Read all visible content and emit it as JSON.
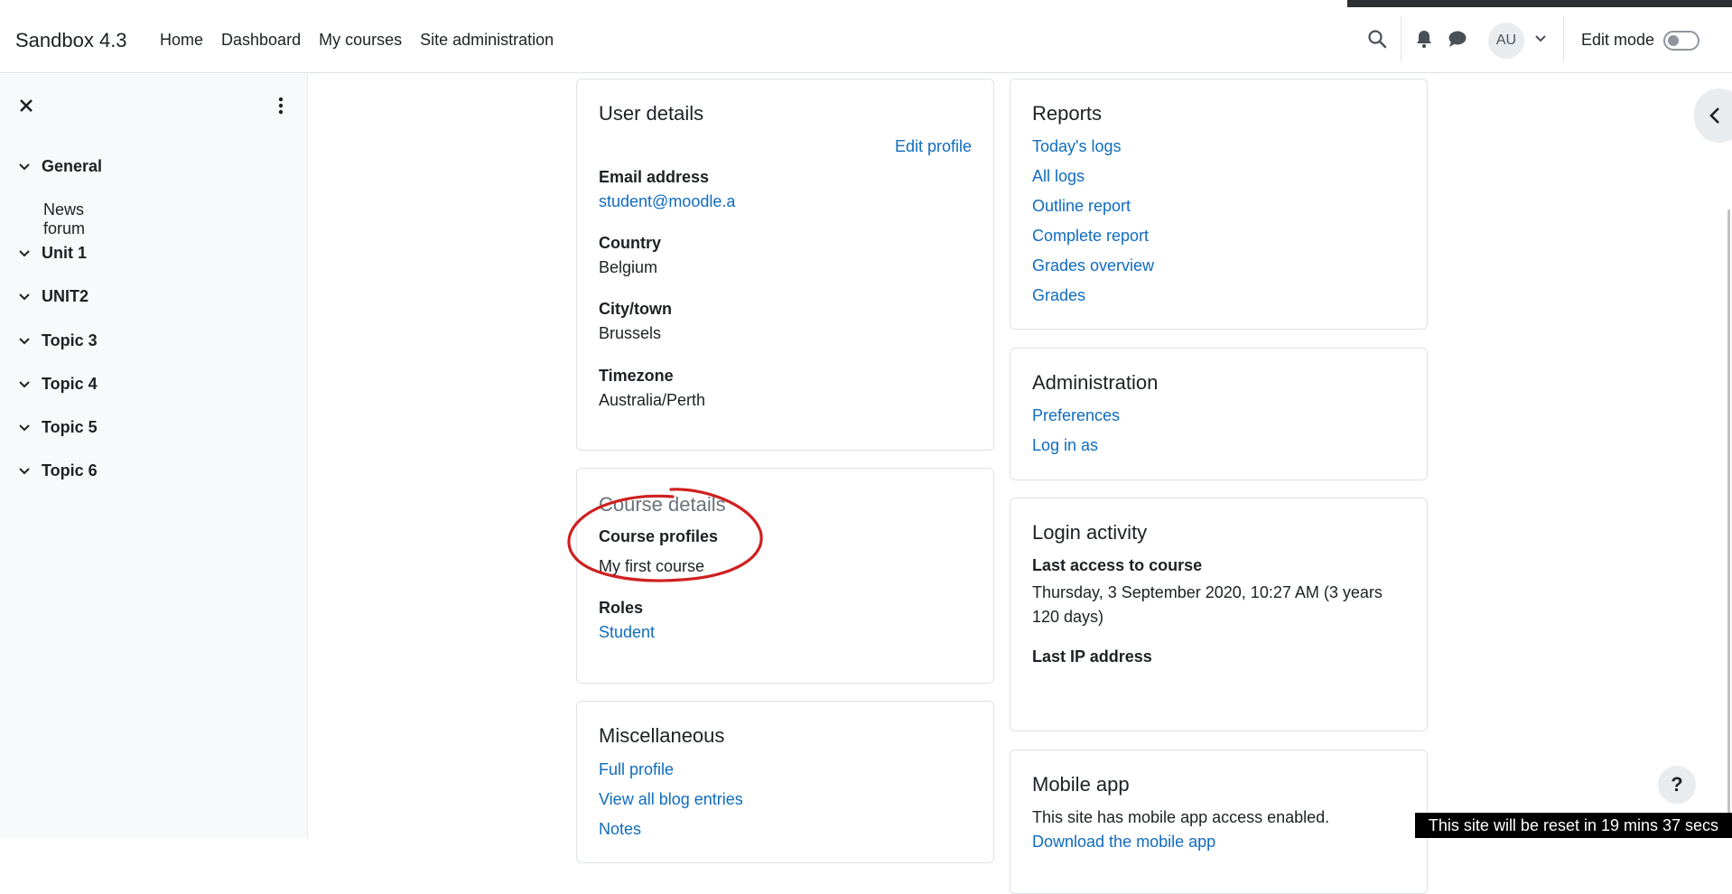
{
  "navbar": {
    "brand": "Sandbox 4.3",
    "links": [
      "Home",
      "Dashboard",
      "My courses",
      "Site administration"
    ],
    "avatar_initials": "AU",
    "edit_mode_label": "Edit mode",
    "edit_mode_on": false
  },
  "course_index": {
    "sections": [
      {
        "label": "General",
        "items": [
          "News forum"
        ]
      },
      {
        "label": "Unit 1",
        "items": []
      },
      {
        "label": "UNIT2",
        "items": []
      },
      {
        "label": "Topic 3",
        "items": []
      },
      {
        "label": "Topic 4",
        "items": []
      },
      {
        "label": "Topic 5",
        "items": []
      },
      {
        "label": "Topic 6",
        "items": []
      }
    ]
  },
  "user_details": {
    "title": "User details",
    "edit_profile": "Edit profile",
    "email_label": "Email address",
    "email_value": "student@moodle.a",
    "country_label": "Country",
    "country_value": "Belgium",
    "city_label": "City/town",
    "city_value": "Brussels",
    "timezone_label": "Timezone",
    "timezone_value": "Australia/Perth"
  },
  "course_details": {
    "title": "Course details",
    "profiles_label": "Course profiles",
    "profiles_value": "My first course",
    "roles_label": "Roles",
    "roles_value": "Student"
  },
  "miscellaneous": {
    "title": "Miscellaneous",
    "links": [
      "Full profile",
      "View all blog entries",
      "Notes"
    ]
  },
  "reports": {
    "title": "Reports",
    "links": [
      "Today's logs",
      "All logs",
      "Outline report",
      "Complete report",
      "Grades overview",
      "Grades"
    ]
  },
  "administration": {
    "title": "Administration",
    "links": [
      "Preferences",
      "Log in as"
    ]
  },
  "login_activity": {
    "title": "Login activity",
    "last_access_label": "Last access to course",
    "last_access_value": "Thursday, 3 September 2020, 10:27 AM  (3 years 120 days)",
    "last_ip_label": "Last IP address"
  },
  "mobile_app": {
    "title": "Mobile app",
    "text": "This site has mobile app access enabled.",
    "link_partial": "Download the mobile app"
  },
  "help_label": "?",
  "reset_banner": "This site will be reset in 19 mins 37 secs",
  "colors": {
    "link": "#0f6cbf",
    "annotation": "#d01f1f",
    "drawer_bg": "#f8f9fa"
  }
}
